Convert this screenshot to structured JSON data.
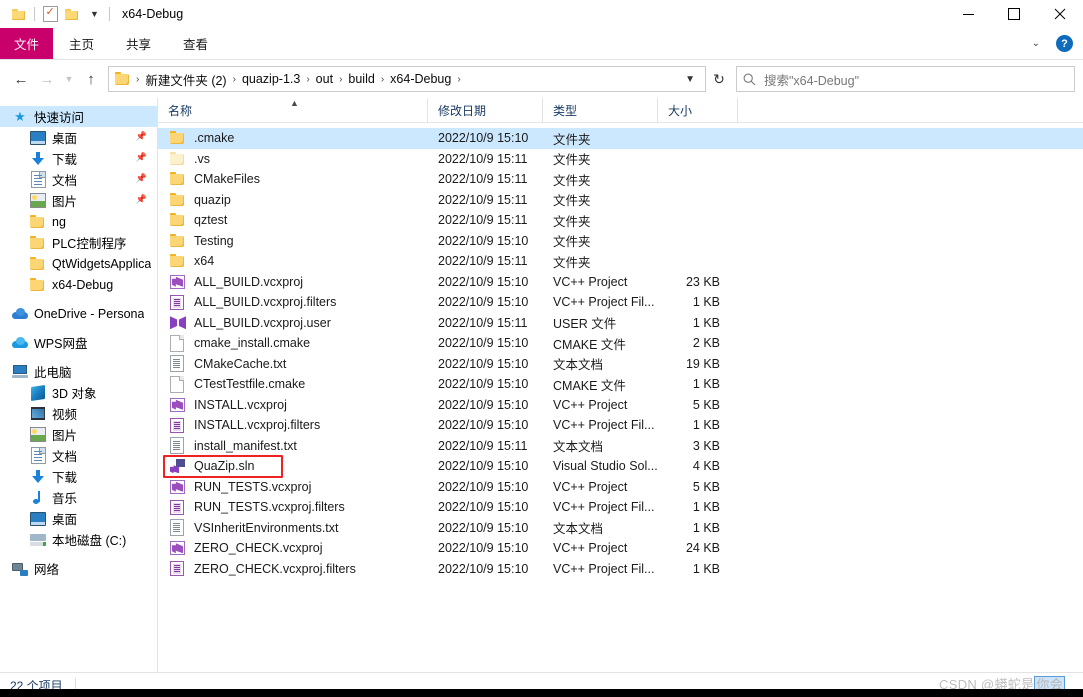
{
  "window": {
    "title": "x64-Debug",
    "quick_access": [
      "folder-icon",
      "properties-icon",
      "new-folder-icon",
      "customize-chevron"
    ],
    "controls": {
      "minimize": "—",
      "maximize": "□",
      "close": "✕"
    }
  },
  "ribbon": {
    "tabs": [
      {
        "label": "文件",
        "active": true
      },
      {
        "label": "主页",
        "active": false
      },
      {
        "label": "共享",
        "active": false
      },
      {
        "label": "查看",
        "active": false
      }
    ],
    "collapse_label": "⌄",
    "help_label": "?",
    "accent_color": "#c9006b"
  },
  "nav": {
    "back": "←",
    "forward": "→",
    "recent": "⌄",
    "up": "↑",
    "refresh": "↻",
    "dropdown": "⌄",
    "breadcrumbs": [
      "新建文件夹 (2)",
      "quazip-1.3",
      "out",
      "build",
      "x64-Debug"
    ],
    "separator": "›"
  },
  "search": {
    "icon": "search-icon",
    "placeholder": "搜索\"x64-Debug\""
  },
  "sidebar": {
    "items": [
      {
        "label": "快速访问",
        "icon": "star-icon",
        "level": 0,
        "selected": true,
        "pinned": false
      },
      {
        "label": "桌面",
        "icon": "desktop-icon",
        "level": 1,
        "selected": false,
        "pinned": true
      },
      {
        "label": "下载",
        "icon": "download-icon",
        "level": 1,
        "selected": false,
        "pinned": true
      },
      {
        "label": "文档",
        "icon": "documents-icon",
        "level": 1,
        "selected": false,
        "pinned": true
      },
      {
        "label": "图片",
        "icon": "pictures-icon",
        "level": 1,
        "selected": false,
        "pinned": true
      },
      {
        "label": "ng",
        "icon": "folder-icon",
        "level": 1,
        "selected": false,
        "pinned": false
      },
      {
        "label": "PLC控制程序",
        "icon": "folder-icon",
        "level": 1,
        "selected": false,
        "pinned": false
      },
      {
        "label": "QtWidgetsApplica",
        "icon": "folder-icon",
        "level": 1,
        "selected": false,
        "pinned": false
      },
      {
        "label": "x64-Debug",
        "icon": "folder-icon",
        "level": 1,
        "selected": false,
        "pinned": false
      },
      {
        "label": "OneDrive - Persona",
        "icon": "onedrive-icon",
        "level": 0,
        "selected": false,
        "pinned": false,
        "gap_before": true
      },
      {
        "label": "WPS网盘",
        "icon": "wps-cloud-icon",
        "level": 0,
        "selected": false,
        "pinned": false,
        "gap_before": true
      },
      {
        "label": "此电脑",
        "icon": "this-pc-icon",
        "level": 0,
        "selected": false,
        "pinned": false,
        "gap_before": true
      },
      {
        "label": "3D 对象",
        "icon": "3d-objects-icon",
        "level": 1,
        "selected": false,
        "pinned": false
      },
      {
        "label": "视频",
        "icon": "videos-icon",
        "level": 1,
        "selected": false,
        "pinned": false
      },
      {
        "label": "图片",
        "icon": "pictures-icon",
        "level": 1,
        "selected": false,
        "pinned": false
      },
      {
        "label": "文档",
        "icon": "documents-icon",
        "level": 1,
        "selected": false,
        "pinned": false
      },
      {
        "label": "下载",
        "icon": "download-icon",
        "level": 1,
        "selected": false,
        "pinned": false
      },
      {
        "label": "音乐",
        "icon": "music-icon",
        "level": 1,
        "selected": false,
        "pinned": false
      },
      {
        "label": "桌面",
        "icon": "desktop-icon",
        "level": 1,
        "selected": false,
        "pinned": false
      },
      {
        "label": "本地磁盘 (C:)",
        "icon": "drive-icon",
        "level": 1,
        "selected": false,
        "pinned": false
      },
      {
        "label": "网络",
        "icon": "network-icon",
        "level": 0,
        "selected": false,
        "pinned": false,
        "gap_before": true
      }
    ]
  },
  "columns": {
    "name": "名称",
    "date": "修改日期",
    "type": "类型",
    "size": "大小",
    "sort_caret": "˄"
  },
  "files": [
    {
      "name": ".cmake",
      "date": "2022/10/9 15:10",
      "type": "文件夹",
      "size": "",
      "icon": "folder-icon",
      "selected": true,
      "boxed": false
    },
    {
      "name": ".vs",
      "date": "2022/10/9 15:11",
      "type": "文件夹",
      "size": "",
      "icon": "folder-pale-icon",
      "selected": false,
      "boxed": false
    },
    {
      "name": "CMakeFiles",
      "date": "2022/10/9 15:11",
      "type": "文件夹",
      "size": "",
      "icon": "folder-icon",
      "selected": false,
      "boxed": false
    },
    {
      "name": "quazip",
      "date": "2022/10/9 15:11",
      "type": "文件夹",
      "size": "",
      "icon": "folder-icon",
      "selected": false,
      "boxed": false
    },
    {
      "name": "qztest",
      "date": "2022/10/9 15:11",
      "type": "文件夹",
      "size": "",
      "icon": "folder-icon",
      "selected": false,
      "boxed": false
    },
    {
      "name": "Testing",
      "date": "2022/10/9 15:10",
      "type": "文件夹",
      "size": "",
      "icon": "folder-icon",
      "selected": false,
      "boxed": false
    },
    {
      "name": "x64",
      "date": "2022/10/9 15:11",
      "type": "文件夹",
      "size": "",
      "icon": "folder-icon",
      "selected": false,
      "boxed": false
    },
    {
      "name": "ALL_BUILD.vcxproj",
      "date": "2022/10/9 15:10",
      "type": "VC++ Project",
      "size": "23 KB",
      "icon": "vcxproj-icon",
      "selected": false,
      "boxed": false
    },
    {
      "name": "ALL_BUILD.vcxproj.filters",
      "date": "2022/10/9 15:10",
      "type": "VC++ Project Fil...",
      "size": "1 KB",
      "icon": "filters-icon",
      "selected": false,
      "boxed": false
    },
    {
      "name": "ALL_BUILD.vcxproj.user",
      "date": "2022/10/9 15:11",
      "type": "USER 文件",
      "size": "1 KB",
      "icon": "user-file-icon",
      "selected": false,
      "boxed": false
    },
    {
      "name": "cmake_install.cmake",
      "date": "2022/10/9 15:10",
      "type": "CMAKE 文件",
      "size": "2 KB",
      "icon": "blank-file-icon",
      "selected": false,
      "boxed": false
    },
    {
      "name": "CMakeCache.txt",
      "date": "2022/10/9 15:10",
      "type": "文本文档",
      "size": "19 KB",
      "icon": "text-file-icon",
      "selected": false,
      "boxed": false
    },
    {
      "name": "CTestTestfile.cmake",
      "date": "2022/10/9 15:10",
      "type": "CMAKE 文件",
      "size": "1 KB",
      "icon": "blank-file-icon",
      "selected": false,
      "boxed": false
    },
    {
      "name": "INSTALL.vcxproj",
      "date": "2022/10/9 15:10",
      "type": "VC++ Project",
      "size": "5 KB",
      "icon": "vcxproj-icon",
      "selected": false,
      "boxed": false
    },
    {
      "name": "INSTALL.vcxproj.filters",
      "date": "2022/10/9 15:10",
      "type": "VC++ Project Fil...",
      "size": "1 KB",
      "icon": "filters-icon",
      "selected": false,
      "boxed": false
    },
    {
      "name": "install_manifest.txt",
      "date": "2022/10/9 15:11",
      "type": "文本文档",
      "size": "3 KB",
      "icon": "text-file-icon",
      "selected": false,
      "boxed": false
    },
    {
      "name": "QuaZip.sln",
      "date": "2022/10/9 15:10",
      "type": "Visual Studio Sol...",
      "size": "4 KB",
      "icon": "sln-icon",
      "selected": false,
      "boxed": true
    },
    {
      "name": "RUN_TESTS.vcxproj",
      "date": "2022/10/9 15:10",
      "type": "VC++ Project",
      "size": "5 KB",
      "icon": "vcxproj-icon",
      "selected": false,
      "boxed": false
    },
    {
      "name": "RUN_TESTS.vcxproj.filters",
      "date": "2022/10/9 15:10",
      "type": "VC++ Project Fil...",
      "size": "1 KB",
      "icon": "filters-icon",
      "selected": false,
      "boxed": false
    },
    {
      "name": "VSInheritEnvironments.txt",
      "date": "2022/10/9 15:10",
      "type": "文本文档",
      "size": "1 KB",
      "icon": "text-file-icon",
      "selected": false,
      "boxed": false
    },
    {
      "name": "ZERO_CHECK.vcxproj",
      "date": "2022/10/9 15:10",
      "type": "VC++ Project",
      "size": "24 KB",
      "icon": "vcxproj-icon",
      "selected": false,
      "boxed": false
    },
    {
      "name": "ZERO_CHECK.vcxproj.filters",
      "date": "2022/10/9 15:10",
      "type": "VC++ Project Fil...",
      "size": "1 KB",
      "icon": "filters-icon",
      "selected": false,
      "boxed": false
    }
  ],
  "statusbar": {
    "count": "22 个项目"
  },
  "watermark": {
    "prefix": "CSDN @蟒蛇是",
    "highlight": "你会"
  },
  "annotation": {
    "highlight_color": "#ee2222"
  }
}
